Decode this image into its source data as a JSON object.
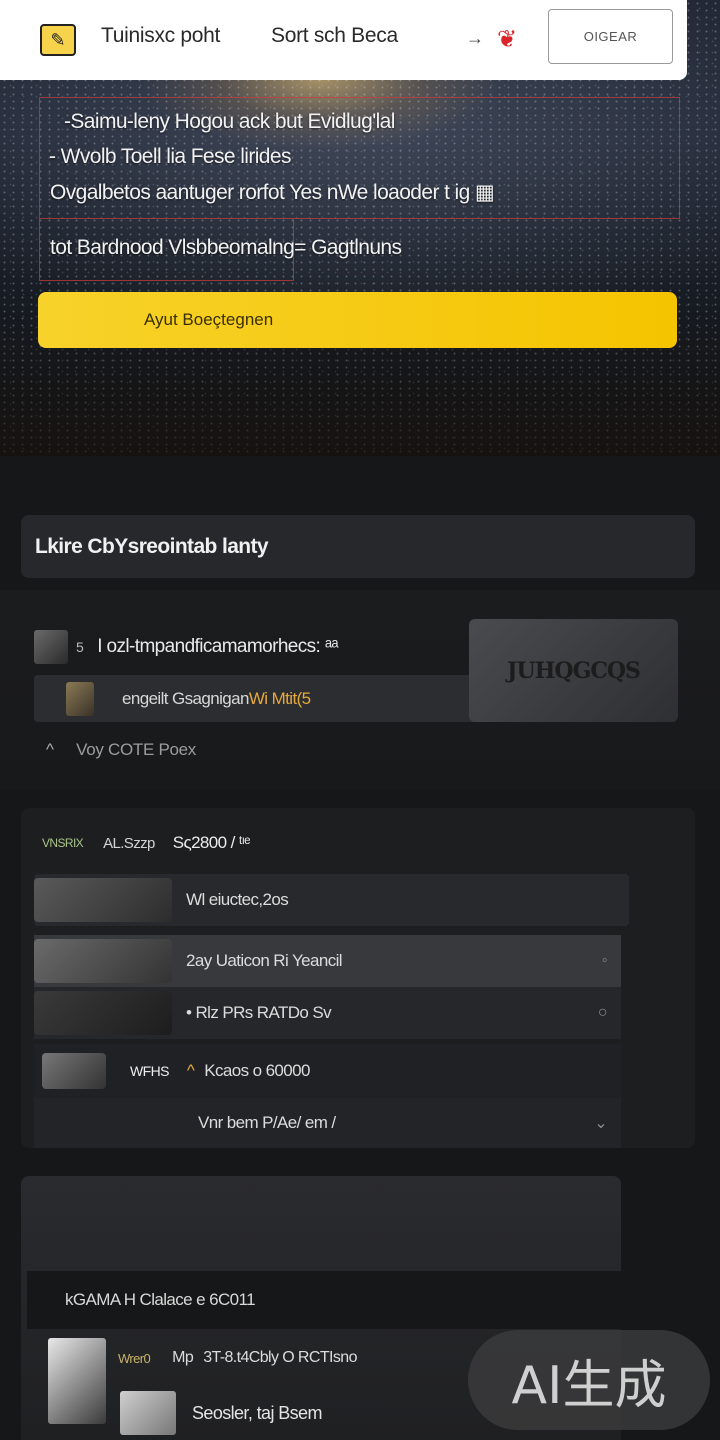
{
  "header": {
    "logo_glyph": "✎",
    "nav": [
      "Tuinisxc  poht",
      "Sort sch Beca"
    ],
    "arrow_glyph": "→",
    "brand_glyph": "❦",
    "button_label": "OIGEAR"
  },
  "hero": {
    "lines": [
      "-Saimu-leny  Hogou ack but Evidlug'lal",
      "- Wvolb Toell lia Fese lirides",
      "Ovgalbetos aantuger rorfot  Yes nWe loaoder t  ig  ▦",
      "tot  Bardnood Vlsbbeomalng= Gagtlnuns"
    ],
    "cta_label": "Ayut  Boeçtegnen"
  },
  "section_title": "Lkire CbYsreointab lanty",
  "card1": {
    "row1_tag": "5",
    "row1_text": "I ozl-tmpandficamamorhecs: ᵃᵃ",
    "row2_text_a": "engeilt  Gsagnigan ",
    "row2_text_b": "Wi Mtit(5",
    "image_text": "JUHQGCQS",
    "row3_caret": "^",
    "row3_text": "Voy  COTE  Poex"
  },
  "card2": {
    "head_brand": "VNSRIX",
    "head_sub": "AL.Szzp",
    "head_value": "Sς2800 / ᵗᶦᵉ",
    "rows": [
      {
        "text": "Wl eiuctec,2os",
        "end": ""
      },
      {
        "text": "2ay Uaticon  Ri  Yeancil",
        "end": "◦"
      },
      {
        "text": "• Rlz PRs    RATDo  Sv",
        "end": "○"
      },
      {
        "label": "WFHS",
        "chev": "^",
        "text": "Kcaos  o 60000",
        "end": ""
      },
      {
        "text": "Vnr bem   P/Ae/ em /",
        "end": "⌄"
      }
    ]
  },
  "card3": {
    "head": "kGAMA   H  Clalace  e  6C011",
    "row_brand": "Wrer0",
    "row_sep": "Mp",
    "row_text": "3T-8.t4Cbly  O RCTIsno",
    "row2_text": "Seosler,  taj   Bsem"
  },
  "watermark": "AI生成"
}
